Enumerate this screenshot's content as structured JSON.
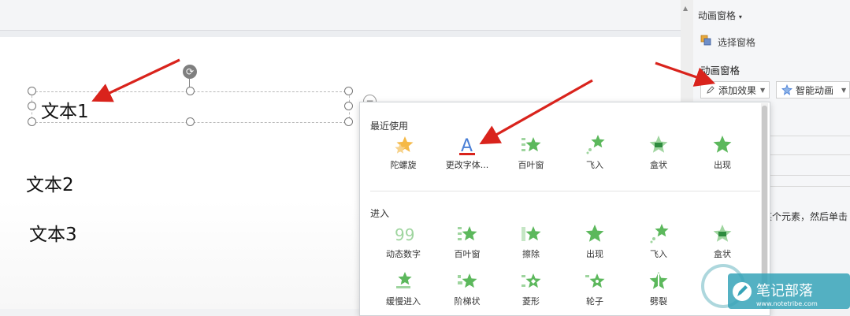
{
  "slide": {
    "text1": "文本1",
    "text2": "文本2",
    "text3": "文本3"
  },
  "side_panel": {
    "title": "动画窗格",
    "select_pane_label": "选择窗格",
    "section_title": "动画窗格",
    "add_effect_label": "添加效果",
    "smart_anim_label": "智能动画",
    "hint_text": "某个元素，然后单击"
  },
  "dropdown": {
    "recent_heading": "最近使用",
    "recent": [
      {
        "label": "陀螺旋",
        "icon": "spin-star-icon"
      },
      {
        "label": "更改字体...",
        "icon": "font-change-icon"
      },
      {
        "label": "百叶窗",
        "icon": "blinds-star-icon"
      },
      {
        "label": "飞入",
        "icon": "fly-in-star-icon"
      },
      {
        "label": "盒状",
        "icon": "box-star-icon"
      },
      {
        "label": "出现",
        "icon": "appear-star-icon"
      }
    ],
    "enter_heading": "进入",
    "enter": [
      {
        "label": "动态数字",
        "icon": "dynamic-number-icon"
      },
      {
        "label": "百叶窗",
        "icon": "blinds-star-icon"
      },
      {
        "label": "擦除",
        "icon": "wipe-star-icon"
      },
      {
        "label": "出现",
        "icon": "appear-star-icon"
      },
      {
        "label": "飞入",
        "icon": "fly-in-star-icon"
      },
      {
        "label": "盒状",
        "icon": "box-star-icon"
      }
    ],
    "enter_row2": [
      {
        "label": "缓慢进入",
        "icon": "slow-enter-star-icon"
      },
      {
        "label": "阶梯状",
        "icon": "stairs-star-icon"
      },
      {
        "label": "菱形",
        "icon": "diamond-star-icon"
      },
      {
        "label": "轮子",
        "icon": "wheel-star-icon"
      },
      {
        "label": "劈裂",
        "icon": "split-star-icon"
      }
    ]
  },
  "watermark": {
    "brand": "笔记部落",
    "url": "www.notetribe.com"
  },
  "colors": {
    "star_green": "#5cb85c",
    "arrow_red": "#d9231c",
    "font_icon_blue": "#4a7fd6"
  }
}
